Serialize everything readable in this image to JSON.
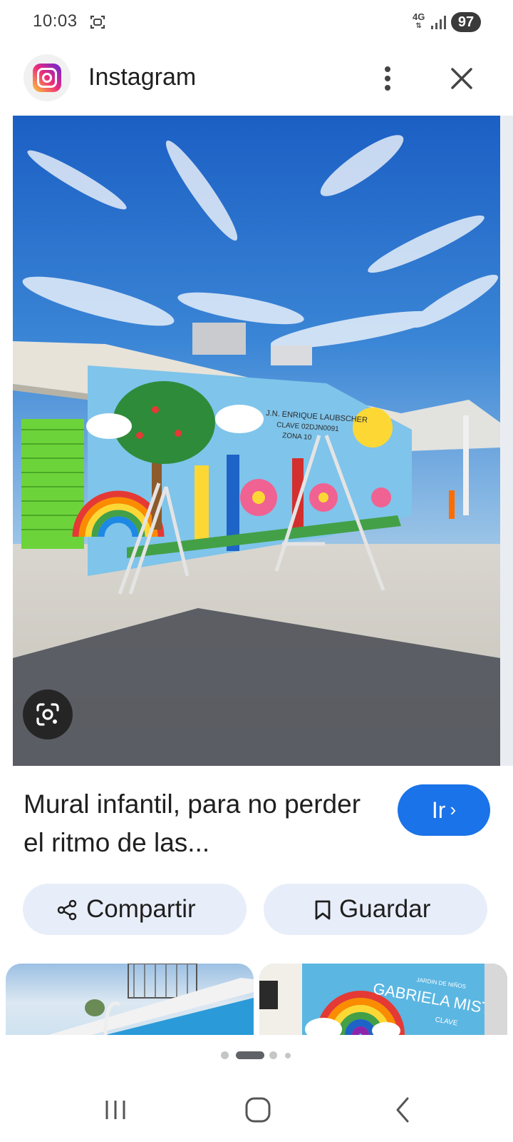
{
  "status_bar": {
    "time": "10:03",
    "network_type": "4G",
    "battery_level": "97",
    "icons": [
      "screen-capture-icon",
      "signal-icon"
    ]
  },
  "header": {
    "app_name": "Instagram",
    "logo_icon": "instagram-logo",
    "menu_icon": "more-vert-icon",
    "close_icon": "close-icon"
  },
  "main_image": {
    "mural_text": [
      "J.N. ENRIQUE LAUBSCHER",
      "CLAVE 02DJN0091",
      "ZONA 10"
    ],
    "lens_icon": "google-lens-icon"
  },
  "result": {
    "title": "Mural infantil, para no perder el ritmo de las...",
    "go_label": "Ir",
    "go_icon": "chevron-right-icon"
  },
  "actions": {
    "share_label": "Compartir",
    "share_icon": "share-icon",
    "save_label": "Guardar",
    "save_icon": "bookmark-icon"
  },
  "related": {
    "thumb2_text": [
      "JARDIN DE NIÑOS",
      "GABRIELA MISTRAL",
      "CLAVE"
    ]
  },
  "pager": {
    "count": 4,
    "active_index": 1
  },
  "nav_bar": {
    "icons": [
      "recent-apps-icon",
      "home-icon",
      "back-icon"
    ]
  },
  "colors": {
    "accent": "#1a73e8",
    "button_bg": "#e8eef9",
    "sky": "#1f66c8",
    "wall": "#7fc4ea"
  }
}
